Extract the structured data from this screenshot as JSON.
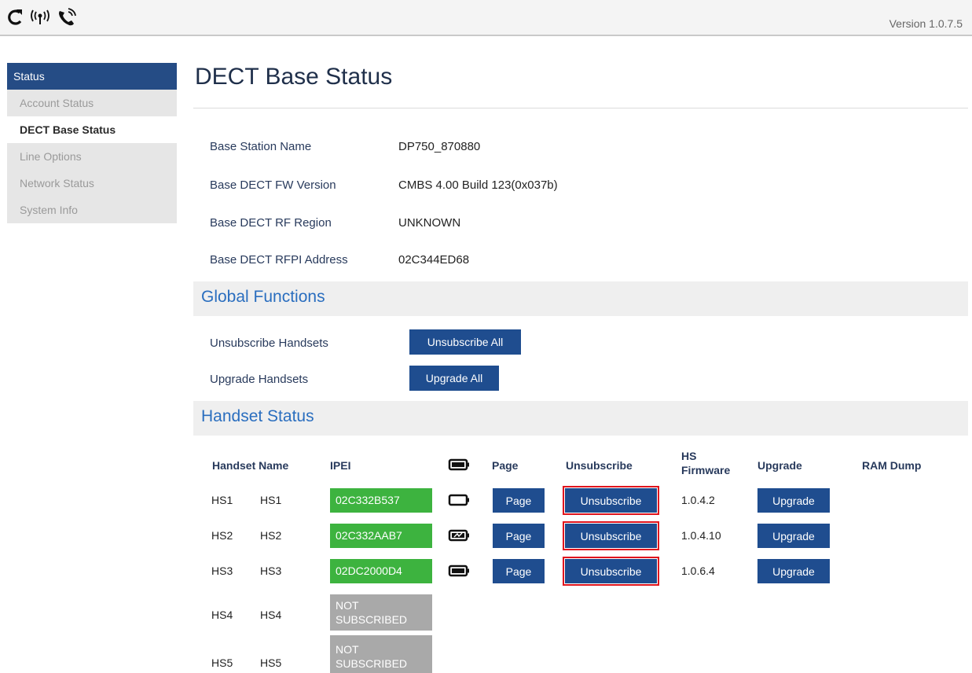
{
  "topbar": {
    "icons": [
      "refresh-icon",
      "wireless-signal-icon",
      "phone-ringing-icon"
    ],
    "version": "Version 1.0.7.5"
  },
  "sidebar": {
    "header": "Status",
    "items": [
      {
        "label": "Account Status",
        "active": false
      },
      {
        "label": "DECT Base Status",
        "active": true
      },
      {
        "label": "Line Options",
        "active": false
      },
      {
        "label": "Network Status",
        "active": false
      },
      {
        "label": "System Info",
        "active": false
      }
    ]
  },
  "page": {
    "title": "DECT Base Status",
    "info": [
      {
        "label": "Base Station Name",
        "value": "DP750_870880"
      },
      {
        "label": "Base DECT FW Version",
        "value": "CMBS 4.00 Build 123(0x037b)"
      },
      {
        "label": "Base DECT RF Region",
        "value": "UNKNOWN"
      },
      {
        "label": "Base DECT RFPI Address",
        "value": "02C344ED68"
      }
    ]
  },
  "global": {
    "title": "Global Functions",
    "unsub_label": "Unsubscribe Handsets",
    "unsub_button": "Unsubscribe All",
    "upgrade_label": "Upgrade Handsets",
    "upgrade_button": "Upgrade All"
  },
  "handsets": {
    "title": "Handset Status",
    "headers": {
      "name": "Handset Name",
      "ipei": "IPEI",
      "page": "Page",
      "unsubscribe": "Unsubscribe",
      "firmware": "HS Firmware",
      "upgrade": "Upgrade",
      "ramdump": "RAM Dump"
    },
    "rows": [
      {
        "id": "HS1",
        "name": "HS1",
        "ipei": "02C332B537",
        "battery": "battery-empty-icon",
        "page": "Page",
        "unsubscribe": "Unsubscribe",
        "firmware": "1.0.4.2",
        "upgrade": "Upgrade"
      },
      {
        "id": "HS2",
        "name": "HS2",
        "ipei": "02C332AAB7",
        "battery": "battery-charging-icon",
        "page": "Page",
        "unsubscribe": "Unsubscribe",
        "firmware": "1.0.4.10",
        "upgrade": "Upgrade"
      },
      {
        "id": "HS3",
        "name": "HS3",
        "ipei": "02DC2000D4",
        "battery": "battery-full-icon",
        "page": "Page",
        "unsubscribe": "Unsubscribe",
        "firmware": "1.0.6.4",
        "upgrade": "Upgrade"
      },
      {
        "id": "HS4",
        "name": "HS4",
        "ipei": "NOT SUBSCRIBED"
      },
      {
        "id": "HS5",
        "name": "HS5",
        "ipei": "NOT SUBSCRIBED"
      }
    ]
  },
  "colors": {
    "nav_header": "#254c85",
    "button": "#1f4d8f",
    "section_title": "#2a6ebf",
    "ipei_subscribed": "#3db33f",
    "ipei_unsubscribed": "#a9a9a9",
    "highlight": "#e0151d"
  }
}
